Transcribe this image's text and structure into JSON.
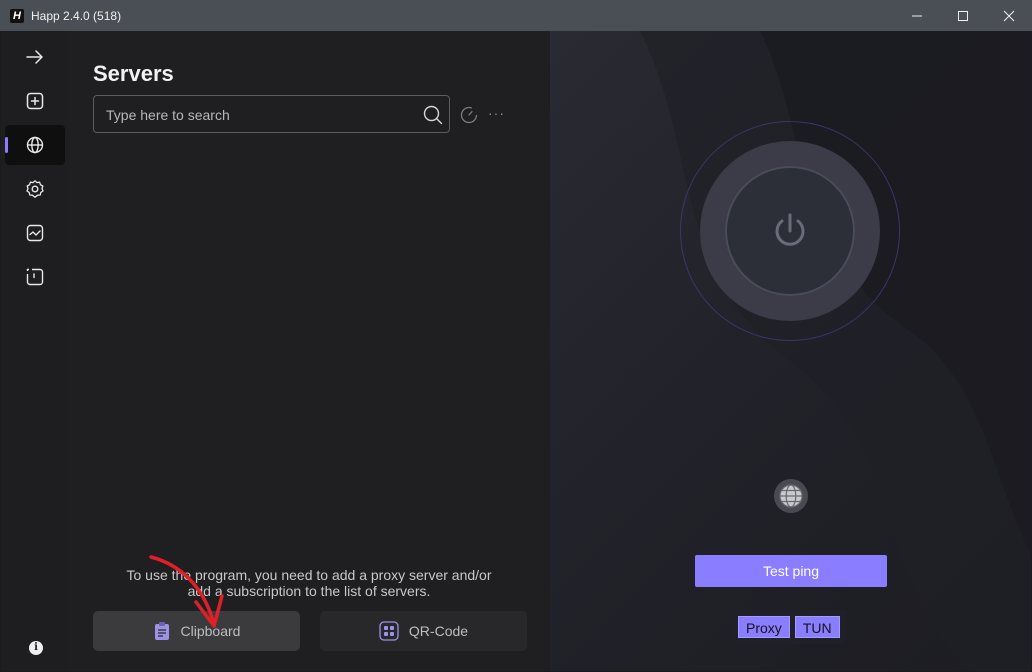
{
  "window": {
    "title": "Happ 2.4.0 (518)",
    "logo_text": "H"
  },
  "sidebar": {
    "items": [
      {
        "name": "connect",
        "icon": "arrow-right-icon"
      },
      {
        "name": "add",
        "icon": "plus-square-icon"
      },
      {
        "name": "servers",
        "icon": "globe-icon",
        "active": true
      },
      {
        "name": "settings",
        "icon": "gear-icon"
      },
      {
        "name": "stats",
        "icon": "activity-icon"
      },
      {
        "name": "scan",
        "icon": "scan-icon"
      }
    ],
    "info_label": "i"
  },
  "servers": {
    "title": "Servers",
    "search_placeholder": "Type here to search",
    "more_label": "···",
    "hint_line1": "To use the program, you need to add a proxy server and/or",
    "hint_line2": "add a subscription to the list of servers.",
    "clipboard_label": "Clipboard",
    "qr_label": "QR-Code"
  },
  "connection": {
    "test_ping_label": "Test ping",
    "modes": [
      "Proxy",
      "TUN"
    ]
  },
  "colors": {
    "accent": "#8b7dff",
    "annotation_arrow": "#e01f26"
  }
}
